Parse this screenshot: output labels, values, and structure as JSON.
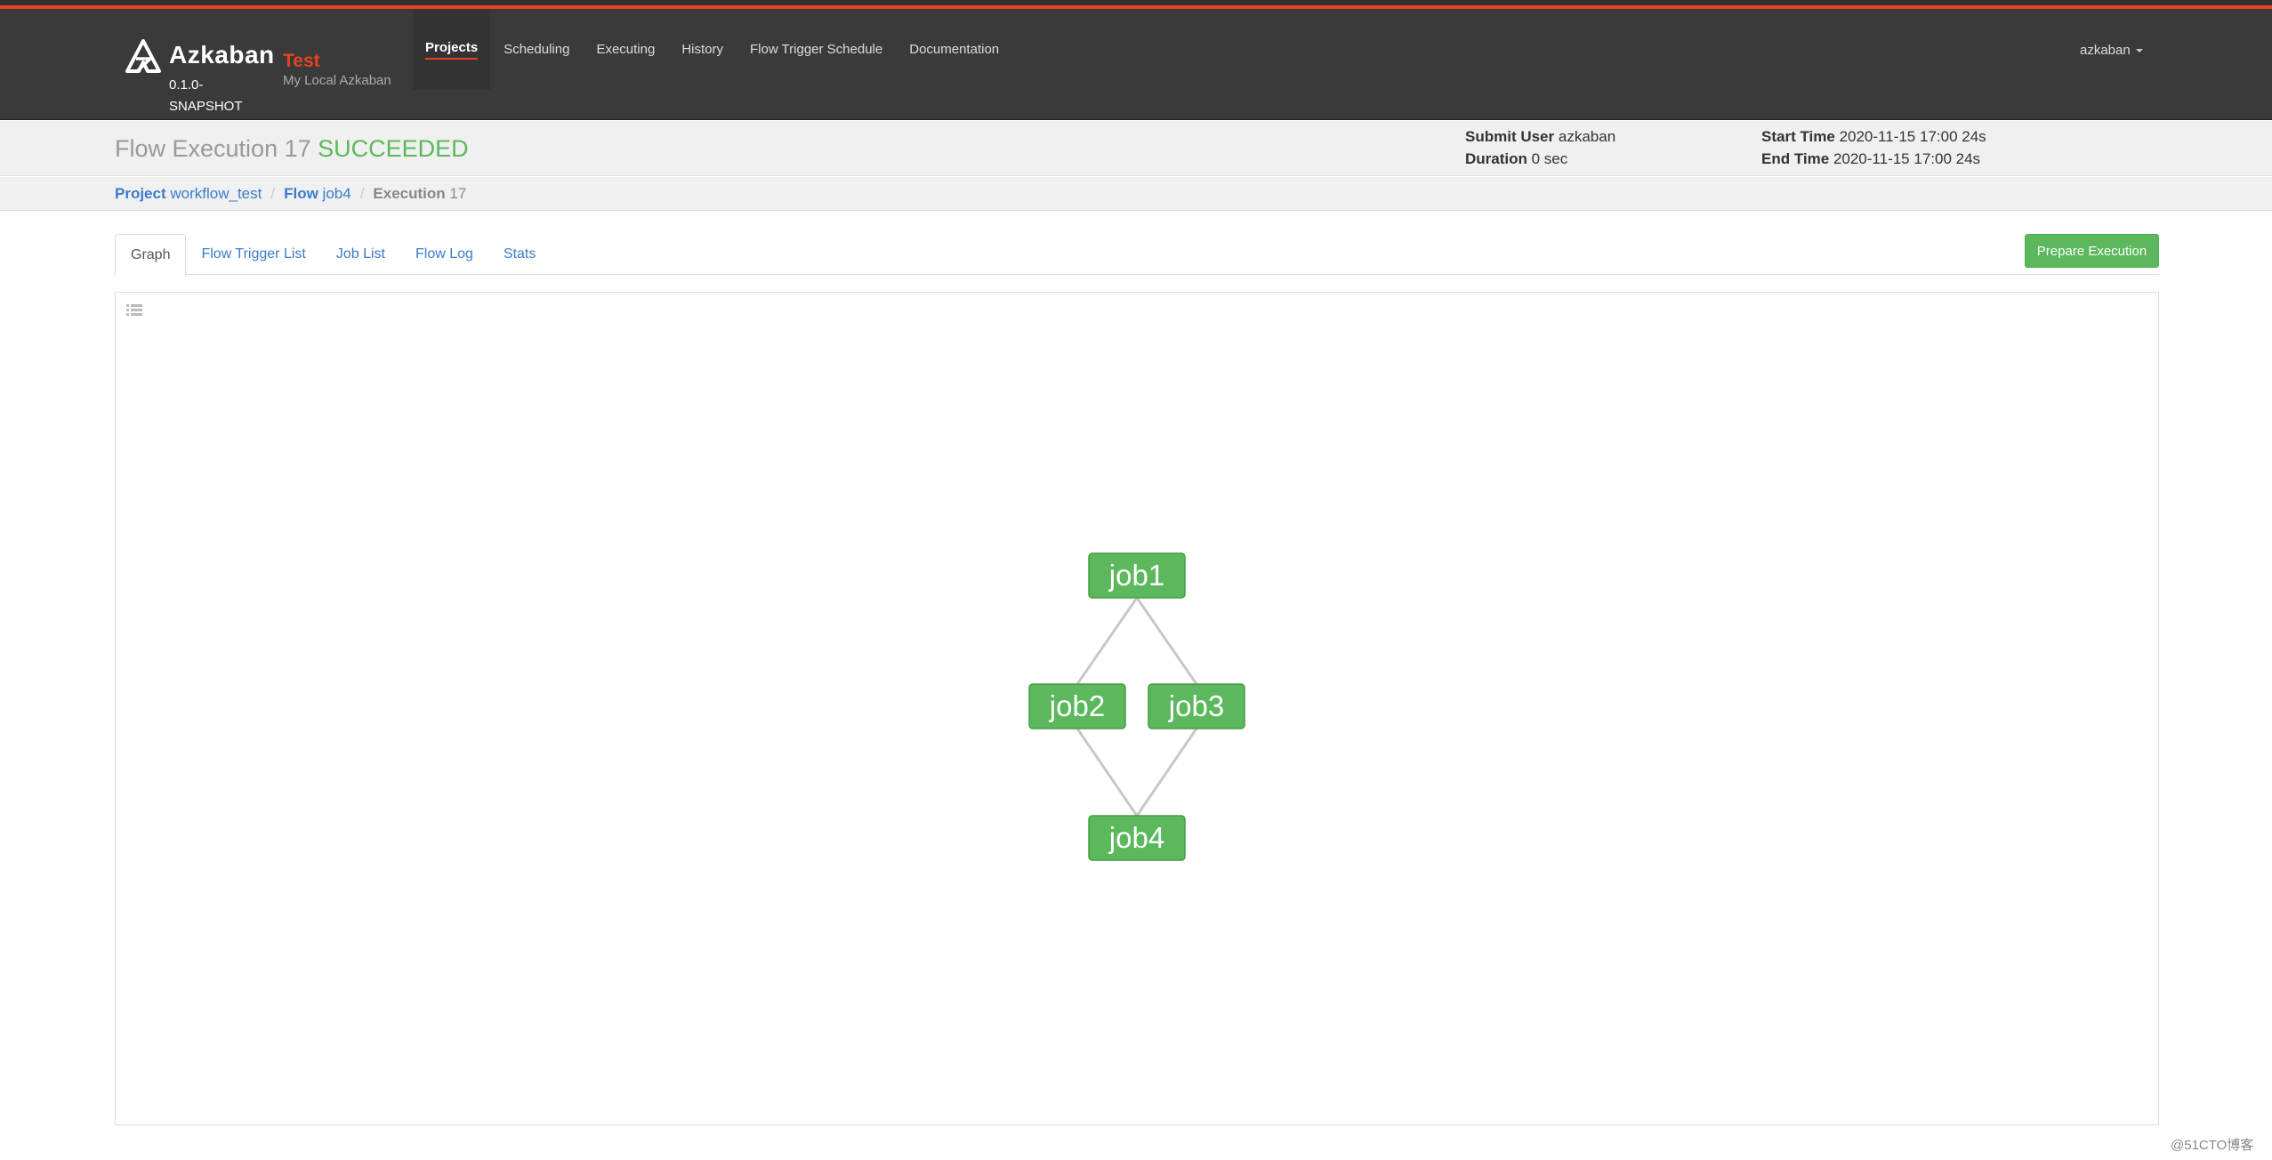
{
  "app": {
    "brand_name": "Azkaban",
    "version": "0.1.0-SNAPSHOT",
    "env_name": "Test",
    "env_desc": "My Local Azkaban",
    "accent_color": "#e8411f",
    "success_color": "#5cb85c",
    "link_color": "#3a7cc9"
  },
  "nav": {
    "items": [
      {
        "label": "Projects",
        "active": true
      },
      {
        "label": "Scheduling"
      },
      {
        "label": "Executing"
      },
      {
        "label": "History"
      },
      {
        "label": "Flow Trigger Schedule"
      },
      {
        "label": "Documentation"
      }
    ],
    "user": "azkaban"
  },
  "header": {
    "title_prefix": "Flow Execution 17",
    "status": "SUCCEEDED",
    "submit_user_label": "Submit User",
    "submit_user": "azkaban",
    "duration_label": "Duration",
    "duration": "0 sec",
    "start_time_label": "Start Time",
    "start_time": "2020-11-15 17:00 24s",
    "end_time_label": "End Time",
    "end_time": "2020-11-15 17:00 24s"
  },
  "breadcrumb": {
    "project_label": "Project",
    "project": "workflow_test",
    "flow_label": "Flow",
    "flow": "job4",
    "execution_label": "Execution",
    "execution": "17"
  },
  "tabs": [
    {
      "label": "Graph",
      "active": true
    },
    {
      "label": "Flow Trigger List"
    },
    {
      "label": "Job List"
    },
    {
      "label": "Flow Log"
    },
    {
      "label": "Stats"
    }
  ],
  "actions": {
    "prepare_execution": "Prepare Execution"
  },
  "graph": {
    "nodes": [
      {
        "id": "job1",
        "label": "job1",
        "status": "SUCCEEDED"
      },
      {
        "id": "job2",
        "label": "job2",
        "status": "SUCCEEDED"
      },
      {
        "id": "job3",
        "label": "job3",
        "status": "SUCCEEDED"
      },
      {
        "id": "job4",
        "label": "job4",
        "status": "SUCCEEDED"
      }
    ],
    "edges": [
      {
        "from": "job1",
        "to": "job2"
      },
      {
        "from": "job1",
        "to": "job3"
      },
      {
        "from": "job2",
        "to": "job4"
      },
      {
        "from": "job3",
        "to": "job4"
      }
    ],
    "list_toggle_icon": "list-icon"
  },
  "watermark": "@51CTO博客"
}
